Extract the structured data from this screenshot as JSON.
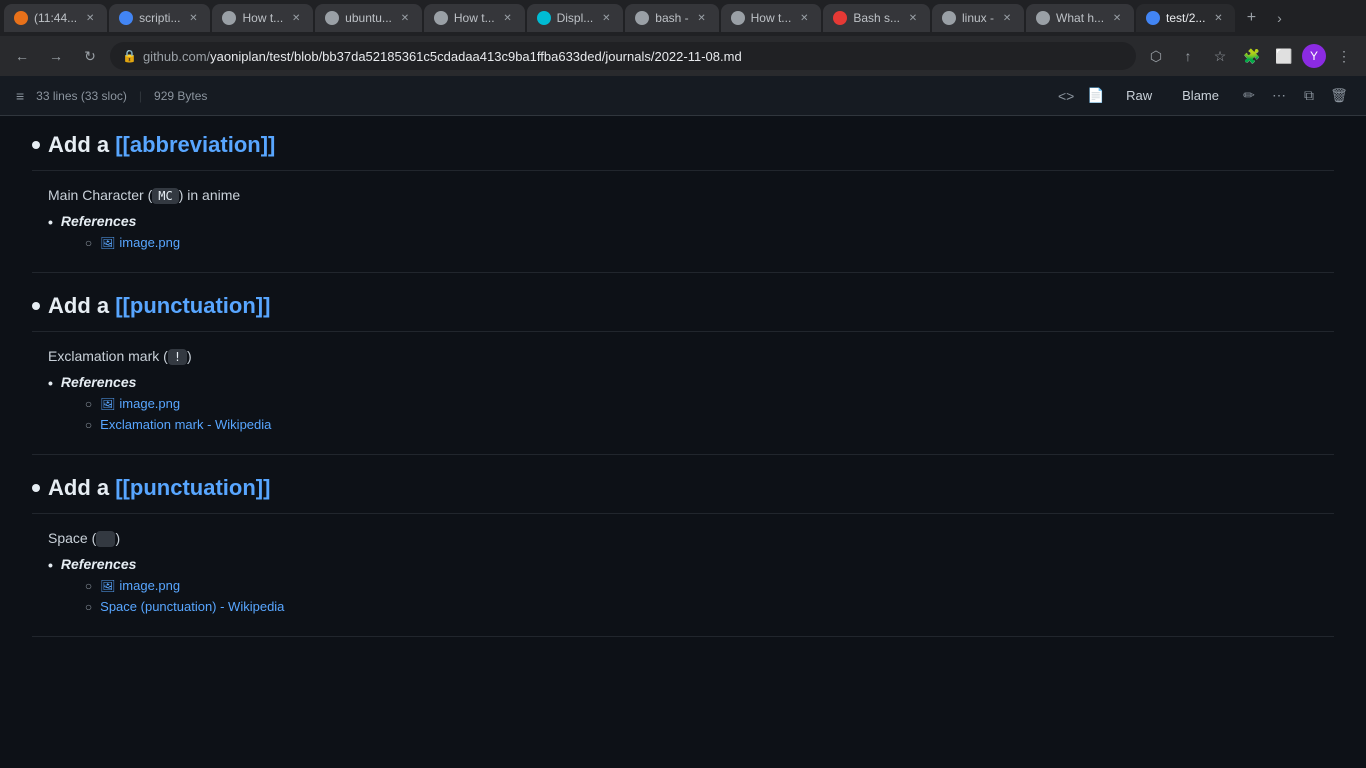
{
  "browser": {
    "tabs": [
      {
        "id": "tab1",
        "favicon_color": "orange",
        "label": "(11:44...",
        "active": false
      },
      {
        "id": "tab2",
        "favicon_color": "blue",
        "label": "scripti...",
        "active": false
      },
      {
        "id": "tab3",
        "favicon_color": "gray",
        "label": "How t...",
        "active": false
      },
      {
        "id": "tab4",
        "favicon_color": "gray",
        "label": "ubuntu...",
        "active": false
      },
      {
        "id": "tab5",
        "favicon_color": "gray",
        "label": "How t...",
        "active": false
      },
      {
        "id": "tab6",
        "favicon_color": "teal",
        "label": "Displ...",
        "active": false
      },
      {
        "id": "tab7",
        "favicon_color": "gray",
        "label": "bash -",
        "active": false
      },
      {
        "id": "tab8",
        "favicon_color": "gray",
        "label": "How t...",
        "active": false
      },
      {
        "id": "tab9",
        "favicon_color": "red",
        "label": "Bash s...",
        "active": false
      },
      {
        "id": "tab10",
        "favicon_color": "gray",
        "label": "linux -",
        "active": false
      },
      {
        "id": "tab11",
        "favicon_color": "gray",
        "label": "What h...",
        "active": false
      },
      {
        "id": "tab12",
        "favicon_color": "blue",
        "label": "test/2...",
        "active": true
      }
    ],
    "url": "github.com/yaoniplan/test/blob/bb37da52185361c5cdadaa413c9ba1ffba633ded/journals/2022-11-08.md",
    "url_prefix": "github.com/",
    "url_suffix": "yaoniplan/test/blob/bb37da52185361c5cdadaa413c9ba1ffba633ded/journals/2022-11-08.md"
  },
  "file_info": {
    "lines_label": "33 lines (33 sloc)",
    "size_label": "929 Bytes",
    "raw_label": "Raw",
    "blame_label": "Blame"
  },
  "sections": [
    {
      "id": "section1",
      "title_prefix": "Add a ",
      "title_wikilink": "[[abbreviation]]",
      "body_text_before": "Main Character (",
      "body_code": "MC",
      "body_text_after": ") in anime",
      "references_label": "References",
      "sub_items": [
        {
          "type": "image",
          "text": "image.png",
          "href": "#"
        }
      ]
    },
    {
      "id": "section2",
      "title_prefix": "Add a ",
      "title_wikilink": "[[punctuation]]",
      "body_text_before": "Exclamation mark (",
      "body_code": "!",
      "body_text_after": ")",
      "references_label": "References",
      "sub_items": [
        {
          "type": "image",
          "text": "image.png",
          "href": "#"
        },
        {
          "type": "link",
          "text": "Exclamation mark - Wikipedia",
          "href": "#"
        }
      ]
    },
    {
      "id": "section3",
      "title_prefix": "Add a ",
      "title_wikilink": "[[punctuation]]",
      "body_text_before": "Space (",
      "body_code": " ",
      "body_text_after": ")",
      "references_label": "References",
      "sub_items": [
        {
          "type": "image",
          "text": "image.png",
          "href": "#"
        },
        {
          "type": "link",
          "text": "Space (punctuation) - Wikipedia",
          "href": "#"
        }
      ]
    }
  ],
  "icons": {
    "back": "←",
    "forward": "→",
    "refresh": "↻",
    "lock": "🔒",
    "share": "↑",
    "star": "☆",
    "extensions": "🧩",
    "menu": "⋮",
    "code_view": "<>",
    "file_view": "📄",
    "edit": "✏",
    "more": "⋯",
    "copy": "⧉",
    "delete": "🗑",
    "list": "≡"
  }
}
